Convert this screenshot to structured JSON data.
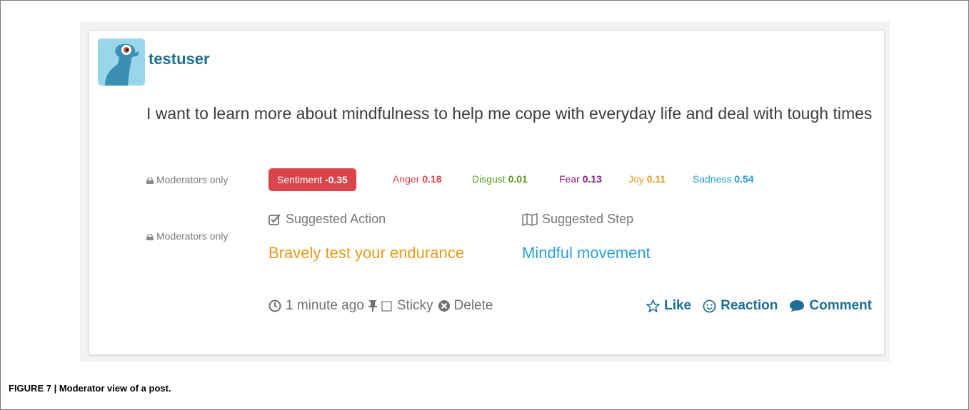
{
  "post": {
    "username": "testuser",
    "text": "I want to learn more about mindfulness to help me cope with everyday life and deal with tough times"
  },
  "moderation": {
    "label_emotions": "Moderators only",
    "label_suggestions": "Moderators only",
    "sentiment": {
      "label": "Sentiment",
      "value": "-0.35",
      "color": "#d9454a"
    },
    "emotions": [
      {
        "label": "Anger",
        "value": "0.18",
        "color": "#d9454a"
      },
      {
        "label": "Disgust",
        "value": "0.01",
        "color": "#5a9e1d"
      },
      {
        "label": "Fear",
        "value": "0.13",
        "color": "#8a1f7e"
      },
      {
        "label": "Joy",
        "value": "0.11",
        "color": "#e39b1c"
      },
      {
        "label": "Sadness",
        "value": "0.54",
        "color": "#2a9ed6"
      }
    ],
    "suggested_action": {
      "heading": "Suggested Action",
      "value": "Bravely test your endurance",
      "color": "#e39b1c"
    },
    "suggested_step": {
      "heading": "Suggested Step",
      "value": "Mindful movement",
      "color": "#2a9ed6"
    }
  },
  "footer": {
    "timestamp": "1 minute ago",
    "sticky_label": "Sticky",
    "delete_label": "Delete",
    "like_label": "Like",
    "reaction_label": "Reaction",
    "comment_label": "Comment"
  },
  "caption": "FIGURE 7 | Moderator view of a post.",
  "colors": {
    "accent": "#1e6f93",
    "text": "#3c3c3c",
    "muted": "#777777"
  },
  "icons": [
    "lock-icon",
    "check-square-icon",
    "map-icon",
    "clock-icon",
    "pin-icon",
    "checkbox-icon",
    "times-circle-icon",
    "star-icon",
    "smile-icon",
    "comment-icon"
  ]
}
